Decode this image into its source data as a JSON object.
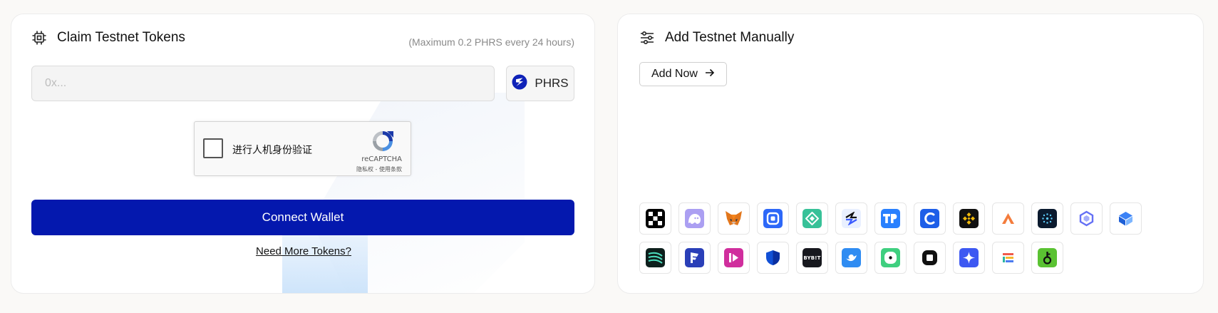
{
  "claim": {
    "title": "Claim Testnet Tokens",
    "max_note": "(Maximum 0.2 PHRS every 24 hours)",
    "address_placeholder": "0x...",
    "address_value": "",
    "token": {
      "label": "PHRS"
    },
    "captcha": {
      "label": "进行人机身份验证",
      "brand": "reCAPTCHA",
      "links": "隐私权 - 使用条款"
    },
    "connect_label": "Connect Wallet",
    "more_tokens_label": "Need More Tokens?"
  },
  "manual": {
    "title": "Add Testnet Manually",
    "add_now_label": "Add Now"
  },
  "wallets": [
    {
      "name": "okx-wallet-icon",
      "bg": "#000000"
    },
    {
      "name": "phantom-wallet-icon",
      "bg": "#ab9ff2"
    },
    {
      "name": "metamask-wallet-icon",
      "bg": "#ffffff"
    },
    {
      "name": "safepal-wallet-icon",
      "bg": "#2d68f8"
    },
    {
      "name": "bitget-wallet-icon",
      "bg": "#37c198"
    },
    {
      "name": "swap-wallet-icon",
      "bg": "#e9f0ff"
    },
    {
      "name": "tokenpocket-wallet-icon",
      "bg": "#2980fe"
    },
    {
      "name": "coin98-wallet-icon",
      "bg": "#1d5ee8"
    },
    {
      "name": "binance-wallet-icon",
      "bg": "#111111"
    },
    {
      "name": "arc-wallet-icon",
      "bg": "#ffffff"
    },
    {
      "name": "particle-wallet-icon",
      "bg": "#0b1a2e"
    },
    {
      "name": "hexagon-wallet-icon",
      "bg": "#ffffff"
    },
    {
      "name": "cube-wallet-icon",
      "bg": "#ffffff"
    },
    {
      "name": "stripes-wallet-icon",
      "bg": "#0d1f1c"
    },
    {
      "name": "flag-wallet-icon",
      "bg": "#2a3fb8"
    },
    {
      "name": "play-wallet-icon",
      "bg": "#d02e9d"
    },
    {
      "name": "shield-wallet-icon",
      "bg": "#ffffff"
    },
    {
      "name": "bybit-wallet-icon",
      "bg": "#17181e",
      "text": "BYB!T"
    },
    {
      "name": "bird-wallet-icon",
      "bg": "#2f8cf2"
    },
    {
      "name": "chat-wallet-icon",
      "bg": "#3fcf7f"
    },
    {
      "name": "square-wallet-icon",
      "bg": "#ffffff"
    },
    {
      "name": "sparkle-wallet-icon",
      "bg": "#3d58f2"
    },
    {
      "name": "bars-wallet-icon",
      "bg": "#ffffff"
    },
    {
      "name": "key-wallet-icon",
      "bg": "#5ac232"
    }
  ],
  "colors": {
    "accent": "#0418ae",
    "border": "#dcdcdc"
  }
}
